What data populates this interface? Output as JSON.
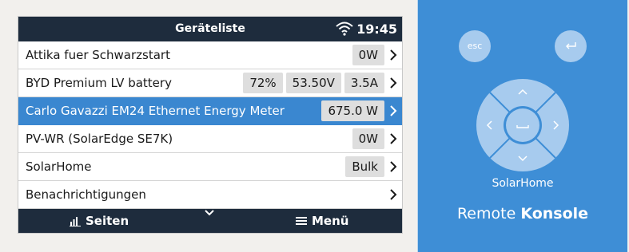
{
  "header": {
    "title": "Geräteliste",
    "time": "19:45"
  },
  "rows": [
    {
      "label": "Attika fuer Schwarzstart",
      "values": [
        "0W"
      ]
    },
    {
      "label": "BYD Premium LV battery",
      "values": [
        "72%",
        "53.50V",
        "3.5A"
      ]
    },
    {
      "label": "Carlo Gavazzi EM24 Ethernet Energy Meter",
      "values": [
        "675.0 W"
      ],
      "selected": true
    },
    {
      "label": "PV-WR (SolarEdge SE7K)",
      "values": [
        "0W"
      ]
    },
    {
      "label": "SolarHome",
      "values": [
        "Bulk"
      ]
    },
    {
      "label": "Benachrichtigungen",
      "values": []
    }
  ],
  "footer": {
    "pages_label": "Seiten",
    "menu_label": "Menü"
  },
  "remote": {
    "esc_label": "esc",
    "device_name": "SolarHome",
    "brand_regular": "Remote",
    "brand_bold": "Konsole"
  },
  "colors": {
    "header_bg": "#1e2c3d",
    "selected_row": "#3a87d0",
    "remote_bg": "#3e8ed6",
    "remote_button": "#a7cbee"
  },
  "icons": [
    "wifi-icon",
    "chevron-right-icon",
    "bar-chart-icon",
    "chevron-down-icon",
    "hamburger-icon",
    "return-icon",
    "dpad-icon"
  ]
}
